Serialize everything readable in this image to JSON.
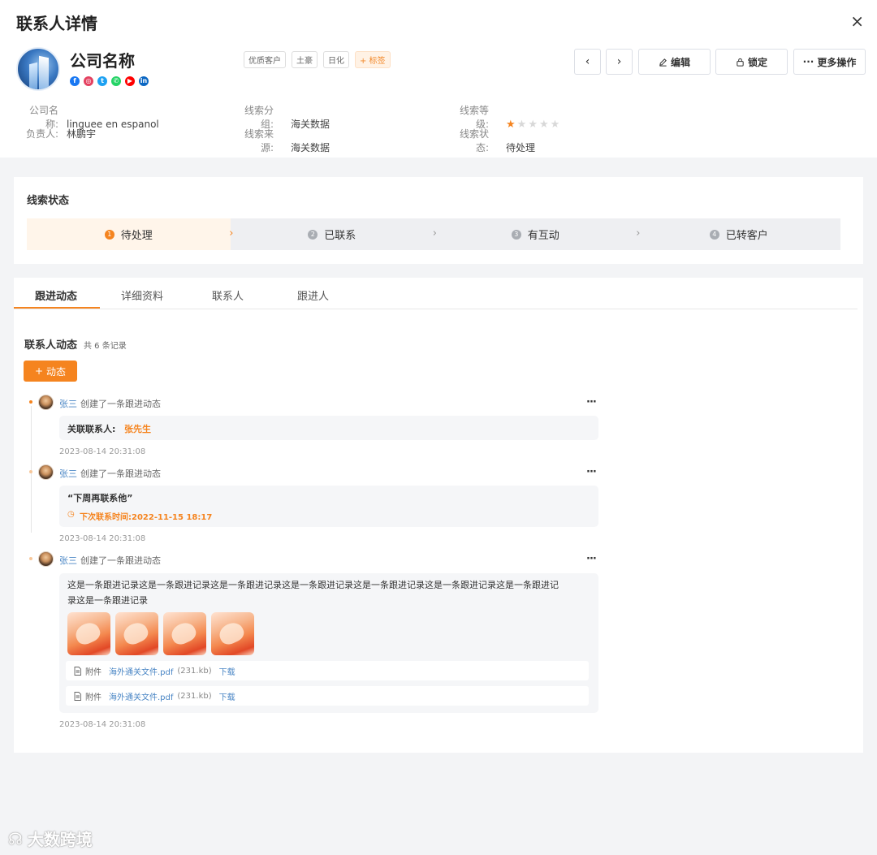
{
  "header": {
    "title": "联系人详情",
    "close_icon": "×",
    "company_name": "公司名称",
    "socials": [
      {
        "icon": "facebook-icon",
        "glyph": "f",
        "color": "#1877f2"
      },
      {
        "icon": "instagram-icon",
        "glyph": "◎",
        "color": "#e4405f"
      },
      {
        "icon": "twitter-icon",
        "glyph": "t",
        "color": "#1da1f2"
      },
      {
        "icon": "whatsapp-icon",
        "glyph": "✆",
        "color": "#25d366"
      },
      {
        "icon": "youtube-icon",
        "glyph": "▶",
        "color": "#ff0000"
      },
      {
        "icon": "linkedin-icon",
        "glyph": "in",
        "color": "#0a66c2"
      }
    ],
    "tags": [
      "优质客户",
      "土豪",
      "日化"
    ],
    "add_tag_label": "+ 标签",
    "prev_label": "‹",
    "next_label": "›",
    "edit_label": "编辑",
    "lock_label": "锁定",
    "more_label": "更多操作"
  },
  "info": {
    "company_label": "公司名称:",
    "company_value": "linguee en espanol",
    "owner_label": "负责人:",
    "owner_value": "林鹏宇",
    "group_label": "线索分组:",
    "group_value": "海关数据",
    "source_label": "线索来源:",
    "source_value": "海关数据",
    "level_label": "线索等级:",
    "level_stars": 1,
    "level_max": 5,
    "status_label": "线索状态:",
    "status_value": "待处理"
  },
  "status": {
    "title": "线索状态",
    "steps": [
      {
        "num": "1",
        "label": "待处理"
      },
      {
        "num": "2",
        "label": "已联系"
      },
      {
        "num": "3",
        "label": "有互动"
      },
      {
        "num": "4",
        "label": "已转客户"
      }
    ],
    "active_step": 0
  },
  "tabs": [
    "跟进动态",
    "详细资料",
    "联系人",
    "跟进人"
  ],
  "activity": {
    "title": "联系人动态",
    "count": "共 6 条记录",
    "add_label": "动态",
    "entries": [
      {
        "who": "张三",
        "action": "创建了一条跟进动态",
        "related_label": "关联联系人:",
        "related_value": "张先生",
        "time": "2023-08-14 20:31:08"
      },
      {
        "who": "张三",
        "action": "创建了一条跟进动态",
        "quote": "“下周再联系他”",
        "next_contact": "下次联系时间:2022-11-15 18:17",
        "time": "2023-08-14 20:31:08"
      },
      {
        "who": "张三",
        "action": "创建了一条跟进动态",
        "text_line1": "这是一条跟进记录这是一条跟进记录这是一条跟进记录这是一条跟进记录这是一条跟进记录这是一条跟进记录这是一条跟进记",
        "text_line2": "录这是一条跟进记录",
        "attachments": [
          {
            "label": "附件",
            "file": "海外通关文件.pdf",
            "size": "(231.kb)",
            "download": "下载"
          },
          {
            "label": "附件",
            "file": "海外通关文件.pdf",
            "size": "(231.kb)",
            "download": "下载"
          }
        ],
        "time": "2023-08-14 20:31:08"
      }
    ]
  },
  "watermark": "大数跨境",
  "colors": {
    "accent": "#f5841f",
    "link": "#4a86c5"
  }
}
